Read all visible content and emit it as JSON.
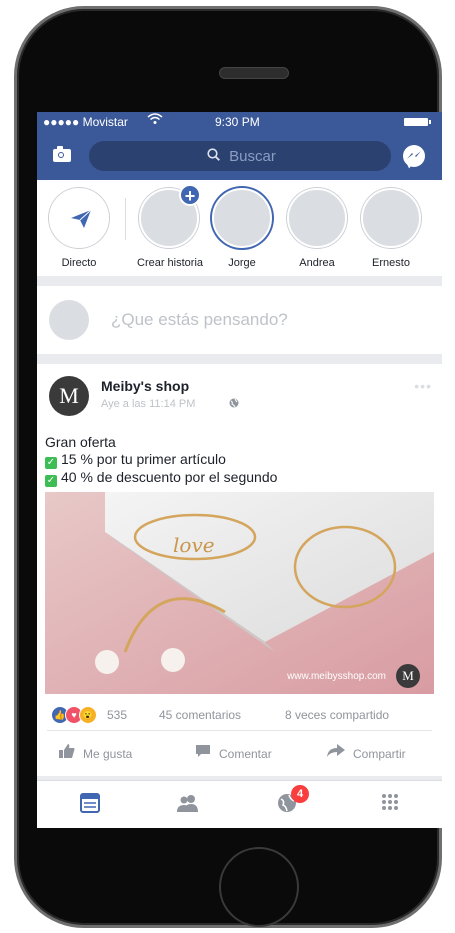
{
  "status_bar": {
    "carrier": "●●●●● Movistar",
    "time": "9:30 PM"
  },
  "navbar": {
    "search_placeholder": "Buscar",
    "camera_icon": "camera-icon",
    "messenger_icon": "messenger-icon"
  },
  "stories": [
    {
      "label": "Directo",
      "icon": "paper-plane-icon"
    },
    {
      "label": "Crear historia",
      "icon": "plus-icon"
    },
    {
      "label": "Jorge"
    },
    {
      "label": "Andrea"
    },
    {
      "label": "Ernesto"
    }
  ],
  "composer": {
    "placeholder": "¿Que estás pensando?"
  },
  "post": {
    "avatar_letter": "M",
    "author": "Meiby's shop",
    "time": "Aye a las 11:14 PM",
    "line1": "Gran oferta",
    "line2": "15 % por tu primer artículo",
    "line3": "40 % de descuento por el segundo",
    "image_word": "love",
    "watermark": "www.meibysshop.com",
    "reaction_count": "535",
    "comments": "45 comentarios",
    "shares": "8 veces compartido",
    "like_label": "Me gusta",
    "comment_label": "Comentar",
    "share_label": "Compartir"
  },
  "tabbar": {
    "badge": "4",
    "icons": [
      "news-feed-icon",
      "friends-icon",
      "notifications-globe-icon",
      "menu-grid-icon"
    ]
  },
  "colors": {
    "brand": "#3b5998",
    "accent": "#4267b2",
    "badge": "#fa3e3e"
  }
}
